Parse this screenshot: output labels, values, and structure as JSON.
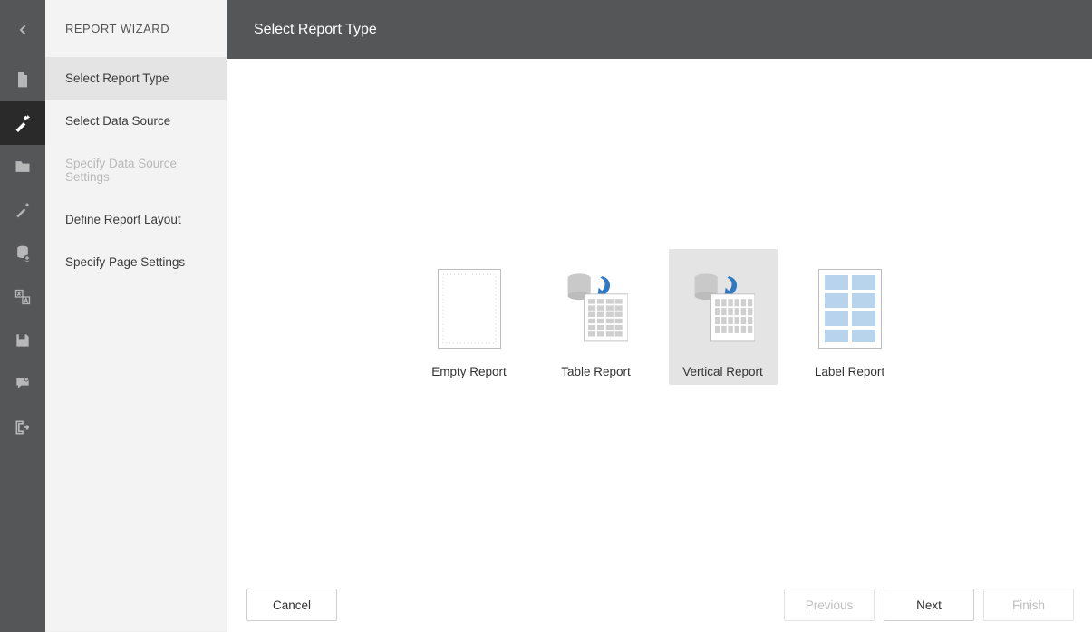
{
  "rail": {
    "icons": [
      "chevron-left-icon",
      "new-page-icon",
      "wizard-icon",
      "folder-icon",
      "magic-wand-icon",
      "database-add-icon",
      "localization-icon",
      "save-icon",
      "comments-icon",
      "exit-icon"
    ],
    "active_index": 2
  },
  "wizard": {
    "title": "REPORT WIZARD",
    "steps": [
      {
        "label": "Select Report Type",
        "state": "active"
      },
      {
        "label": "Select Data Source",
        "state": "normal"
      },
      {
        "label": "Specify Data Source Settings",
        "state": "disabled"
      },
      {
        "label": "Define Report Layout",
        "state": "normal"
      },
      {
        "label": "Specify Page Settings",
        "state": "normal"
      }
    ]
  },
  "header": {
    "title": "Select Report Type"
  },
  "options": [
    {
      "icon": "empty-report-icon",
      "label": "Empty Report",
      "selected": false
    },
    {
      "icon": "table-report-icon",
      "label": "Table Report",
      "selected": false
    },
    {
      "icon": "vertical-report-icon",
      "label": "Vertical Report",
      "selected": true
    },
    {
      "icon": "label-report-icon",
      "label": "Label Report",
      "selected": false
    }
  ],
  "footer": {
    "cancel": "Cancel",
    "previous": "Previous",
    "next": "Next",
    "finish": "Finish",
    "previous_disabled": true,
    "finish_disabled": true
  }
}
